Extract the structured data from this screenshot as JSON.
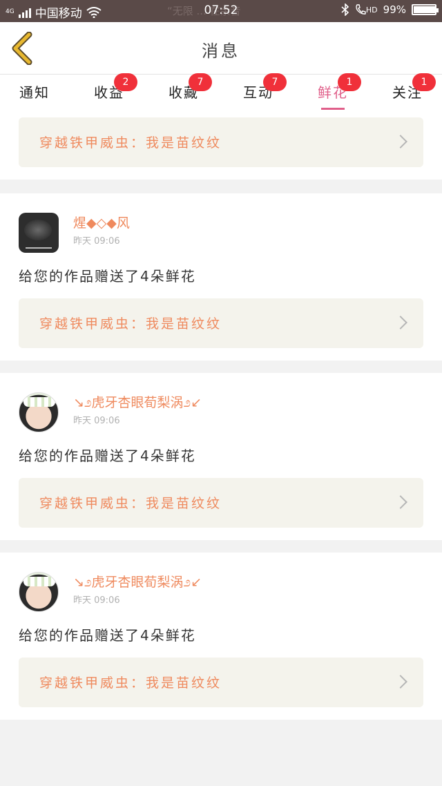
{
  "status_bar": {
    "network": "4G",
    "carrier": "中国移动",
    "marquee": "“无限 ... 在余音",
    "time": "07:52",
    "hd_label": "HD",
    "battery": "99%",
    "battery_level": 0.99
  },
  "nav": {
    "title": "消息",
    "back_icon": "chevron-left-icon",
    "accent_color": "#e8b830"
  },
  "tabs": [
    {
      "label": "通知",
      "badge": ""
    },
    {
      "label": "收益",
      "badge": "2"
    },
    {
      "label": "收藏",
      "badge": "7"
    },
    {
      "label": "互动",
      "badge": "7"
    },
    {
      "label": "鲜花",
      "badge": "1",
      "active": true
    },
    {
      "label": "关注",
      "badge": "1"
    }
  ],
  "colors": {
    "active_tab": "#e05f8a",
    "badge": "#f0303a",
    "name": "#ef8a5e"
  },
  "messages": [
    {
      "name": "煋◆◇◆风",
      "time": "昨天 09:06",
      "text": "给您的作品赠送了4朵鲜花",
      "work": "穿越铁甲威虫：我是苗纹纹",
      "avatar": "dark"
    },
    {
      "name": "煋◆◇◆风",
      "time": "昨天 09:06",
      "text": "给您的作品赠送了4朵鲜花",
      "work": "穿越铁甲威虫：我是苗纹纹",
      "avatar": "dark"
    },
    {
      "name": "↘೨虎牙杏眼荀梨涡೨↙",
      "time": "昨天 09:06",
      "text": "给您的作品赠送了4朵鲜花",
      "work": "穿越铁甲威虫：我是苗纹纹",
      "avatar": "light"
    },
    {
      "name": "↘೨虎牙杏眼荀梨涡೨↙",
      "time": "昨天 09:06",
      "text": "给您的作品赠送了4朵鲜花",
      "work": "穿越铁甲威虫：我是苗纹纹",
      "avatar": "light"
    }
  ]
}
